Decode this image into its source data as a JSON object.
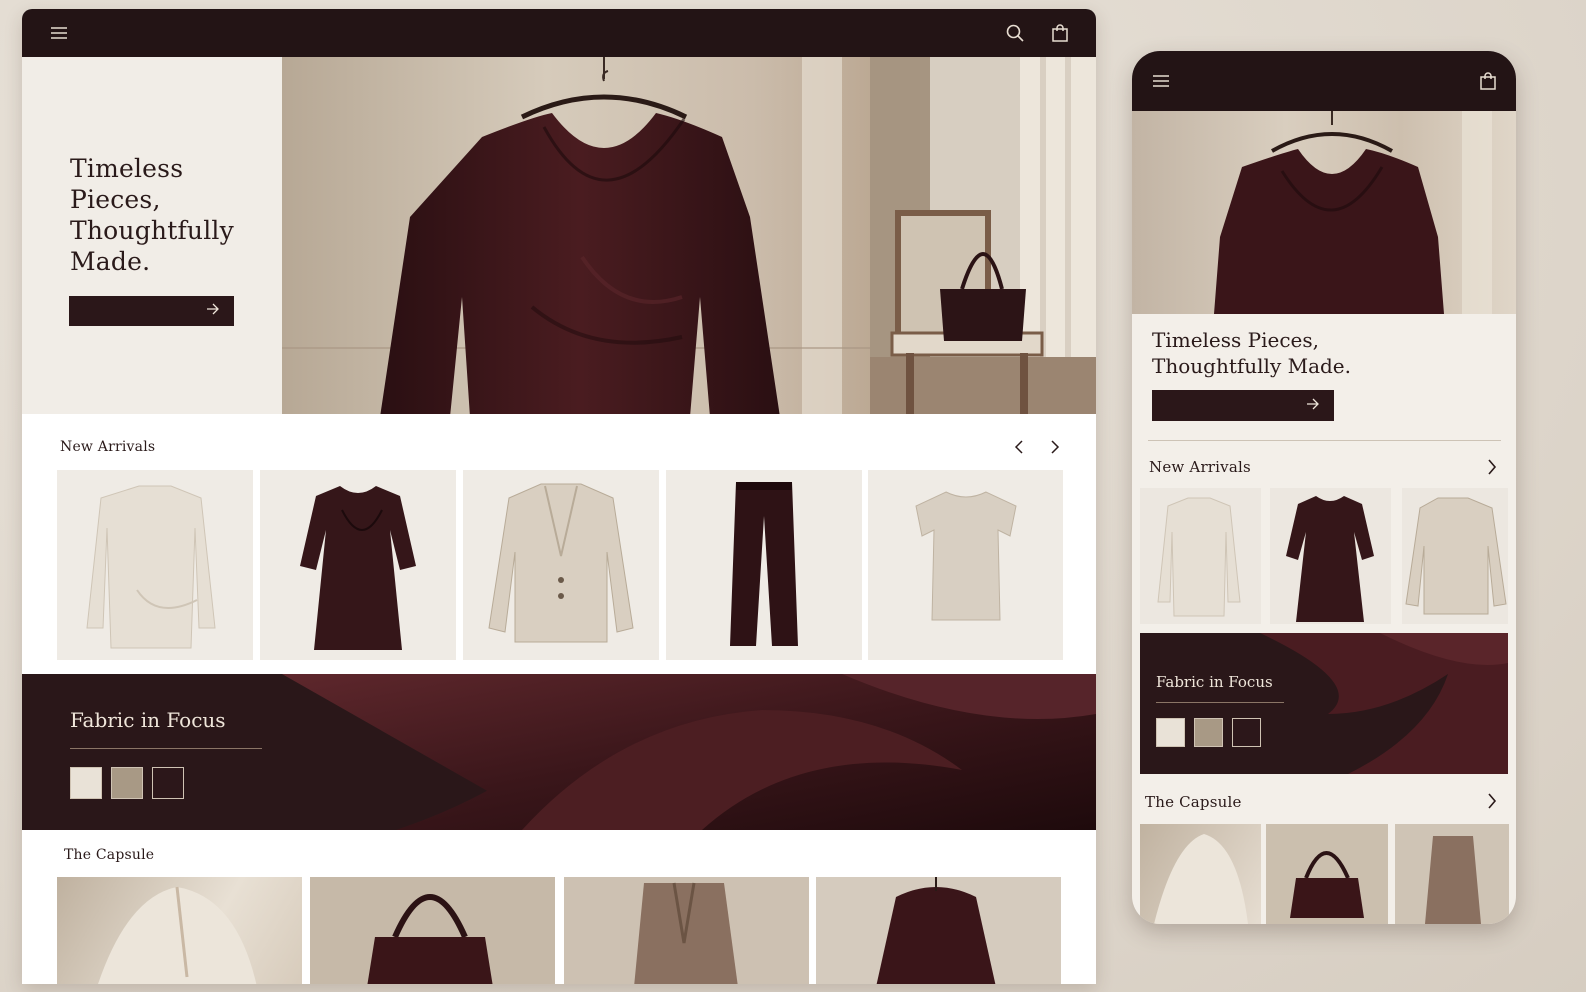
{
  "desktop": {
    "nav": {
      "menu_icon": "hamburger-menu-icon",
      "search_icon": "search-icon",
      "bag_icon": "shopping-bag-icon"
    },
    "hero": {
      "title_lines": [
        "Timeless",
        "Pieces,",
        "Thoughtfully",
        "Made."
      ],
      "cta_icon": "arrow-right-icon"
    },
    "new_arrivals": {
      "title": "New Arrivals",
      "products": [
        "blouse",
        "dress",
        "blazer",
        "trousers",
        "knit-vest"
      ]
    },
    "fabric": {
      "title": "Fabric in Focus",
      "swatches": [
        "#e9e2d7",
        "#a89985",
        "#2c171a"
      ]
    },
    "capsule": {
      "title": "The Capsule"
    }
  },
  "mobile": {
    "hero": {
      "title_line1": "Timeless Pieces,",
      "title_line2": "Thoughtfully Made."
    },
    "new_arrivals": {
      "title": "New Arrivals"
    },
    "fabric": {
      "title": "Fabric in Focus",
      "swatches": [
        "#e9e2d7",
        "#a89985",
        "#2c171a"
      ]
    },
    "capsule": {
      "title": "The Capsule"
    }
  },
  "colors": {
    "brand_dark": "#231415",
    "accent_burgundy": "#3a1a1e",
    "cream": "#f1ede7"
  }
}
